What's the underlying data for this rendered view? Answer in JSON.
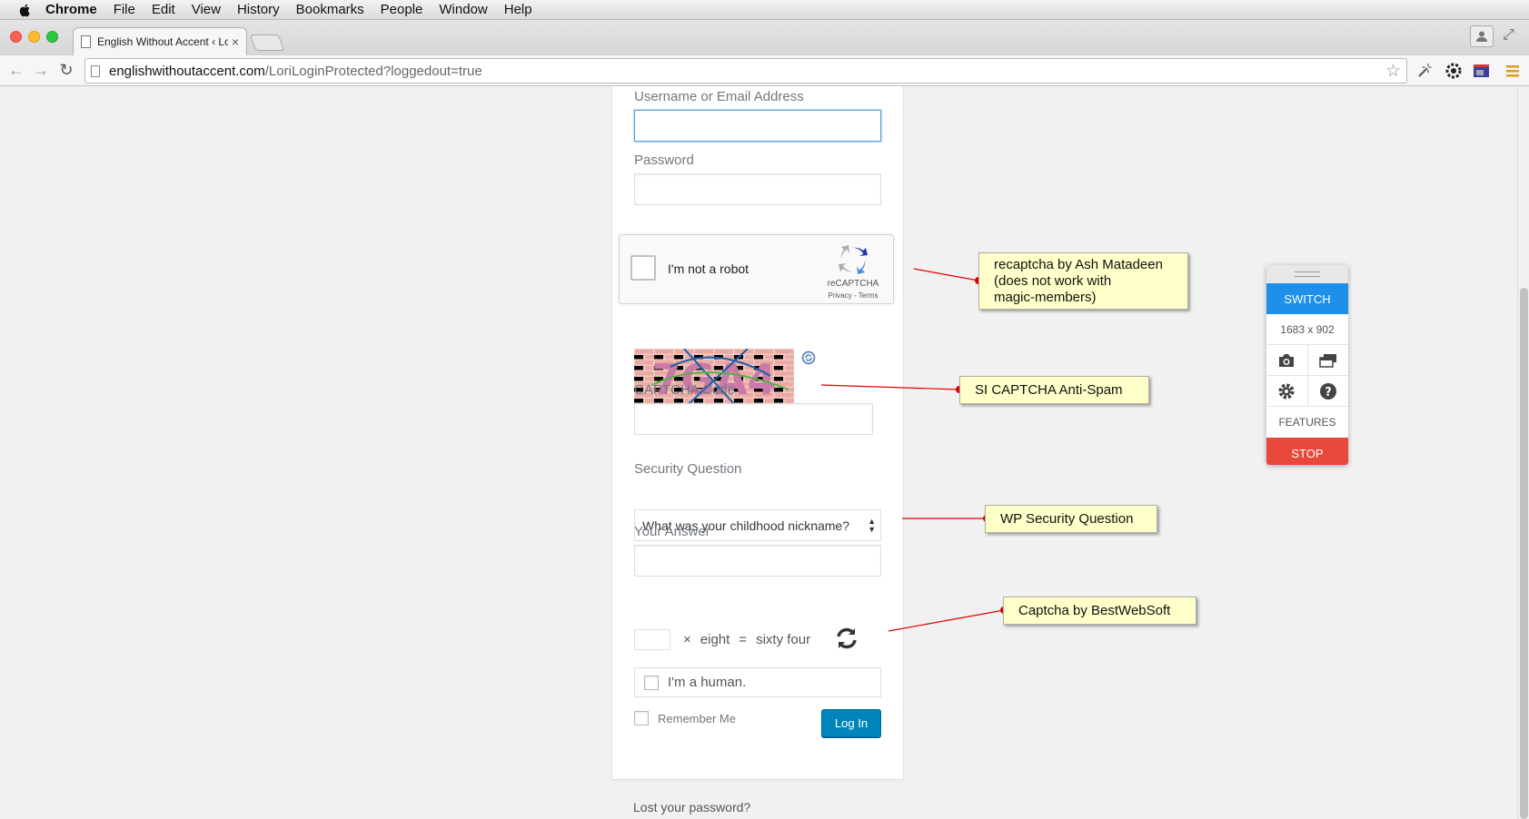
{
  "menubar": {
    "app": "Chrome",
    "items": [
      "File",
      "Edit",
      "View",
      "History",
      "Bookmarks",
      "People",
      "Window",
      "Help"
    ]
  },
  "tab": {
    "title": "English Without Accent ‹ Lo",
    "close": "×"
  },
  "omnibox": {
    "host": "englishwithoutaccent.com",
    "path": "/LoriLoginProtected?loggedout=true"
  },
  "form": {
    "username_label": "Username or Email Address",
    "password_label": "Password",
    "recaptcha": {
      "label": "I'm not a robot",
      "brand": "reCAPTCHA",
      "links": "Privacy - Terms"
    },
    "captcha_label": "CAPTCHA Code",
    "captcha_image_text": "7GA4",
    "security_question_label": "Security Question",
    "security_question_value": "What was your childhood nickname?",
    "answer_label": "Your Answer",
    "math": {
      "operator": "×",
      "operand": "eight",
      "equals": "=",
      "result": "sixty four"
    },
    "human_label": "I'm a human.",
    "remember_label": "Remember Me",
    "login_button": "Log In"
  },
  "lost_password": "Lost your password?",
  "annotations": {
    "note1": "recaptcha by Ash Matadeen\n(does not work with\nmagic-members)",
    "note2": "SI CAPTCHA Anti-Spam",
    "note3": "WP Security Question",
    "note4": "Captcha by BestWebSoft"
  },
  "resizer": {
    "switch": "SWITCH",
    "size": "1683 x 902",
    "features": "FEATURES",
    "stop": "STOP"
  },
  "colors": {
    "accent": "#0085ba",
    "note_bg": "#ffffc9",
    "arrow": "#e00000",
    "switch": "#1e90e9",
    "stop": "#e8473b"
  }
}
